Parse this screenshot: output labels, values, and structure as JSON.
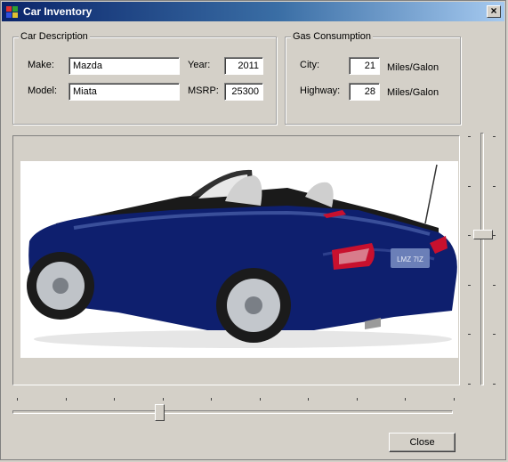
{
  "window": {
    "title": "Car Inventory",
    "close_glyph": "×"
  },
  "car_description": {
    "legend": "Car Description",
    "make_label": "Make:",
    "make_value": "Mazda",
    "model_label": "Model:",
    "model_value": "Miata",
    "year_label": "Year:",
    "year_value": "2011",
    "msrp_label": "MSRP:",
    "msrp_value": "25300"
  },
  "gas_consumption": {
    "legend": "Gas Consumption",
    "city_label": "City:",
    "city_value": "21",
    "city_unit": "Miles/Galon",
    "highway_label": "Highway:",
    "highway_value": "28",
    "highway_unit": "Miles/Galon"
  },
  "picture": {
    "car_color": "#0e1f6e",
    "plate_text": "LMZ 7IZ"
  },
  "sliders": {
    "vertical": {
      "ticks": 6
    },
    "horizontal": {
      "ticks": 10
    }
  },
  "buttons": {
    "close_label": "Close"
  }
}
